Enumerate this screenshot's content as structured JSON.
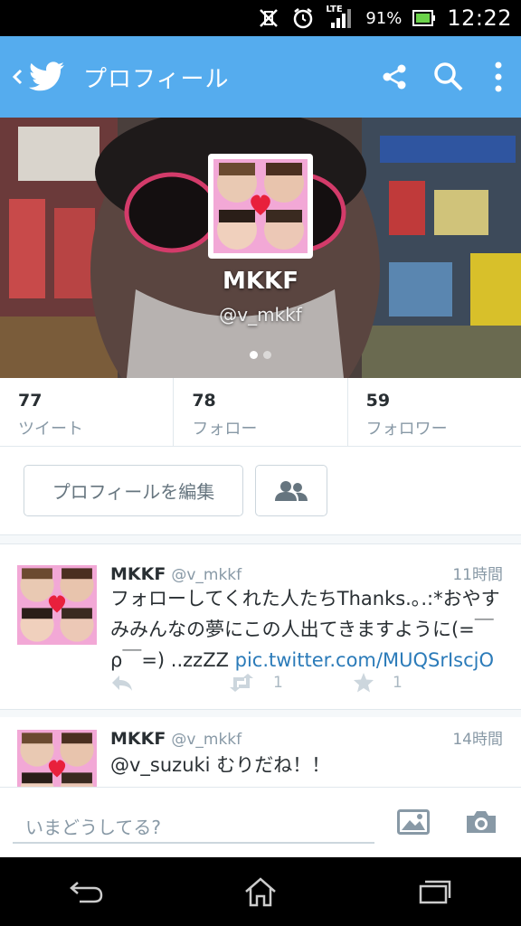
{
  "status_bar": {
    "network": "LTE",
    "battery": "91%",
    "time": "12:22"
  },
  "app_bar": {
    "title": "プロフィール"
  },
  "profile": {
    "name": "MKKF",
    "handle": "@v_mkkf"
  },
  "stats": [
    {
      "count": "77",
      "label": "ツイート"
    },
    {
      "count": "78",
      "label": "フォロー"
    },
    {
      "count": "59",
      "label": "フォロワー"
    }
  ],
  "edit_profile_label": "プロフィールを編集",
  "tweets": [
    {
      "name": "MKKF",
      "handle": "@v_mkkf",
      "time": "11時間",
      "text": "フォローしてくれた人たちThanks.｡.:*おやすみみんなの夢にこの人出てきますように(=￣ρ￣=) ..zzZZ ",
      "link": "pic.twitter.com/MUQSrIscjO",
      "retweets": "1",
      "favorites": "1"
    },
    {
      "name": "MKKF",
      "handle": "@v_mkkf",
      "time": "14時間",
      "mention": "@v_suzuki",
      "text": " むりだね！！"
    }
  ],
  "compose": {
    "placeholder": "いまどうしてる?"
  },
  "colors": {
    "brand": "#55acee",
    "link": "#2b7bb9",
    "muted": "#8899a6"
  }
}
